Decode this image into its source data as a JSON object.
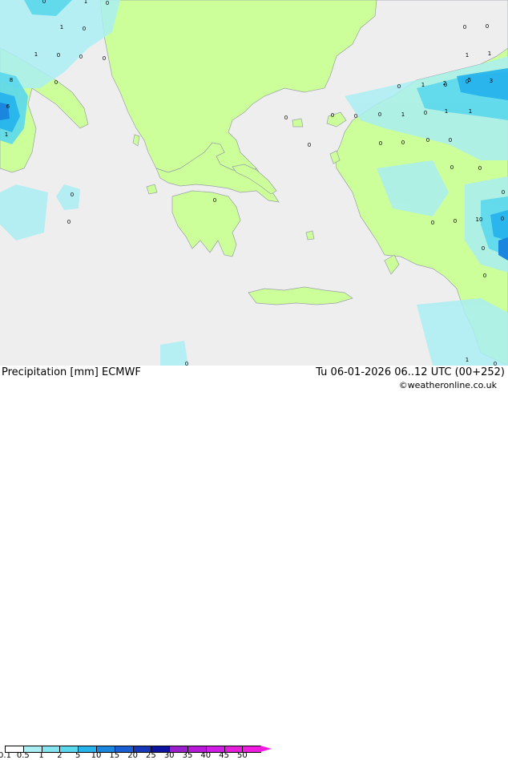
{
  "header": {
    "title": "Precipitation [mm] ECMWF",
    "run_info": "Tu 06-01-2026 06..12 UTC (00+252)",
    "credit": "©weatheronline.co.uk"
  },
  "colors": {
    "sea": "#eeeeee",
    "land": "#ccff99",
    "coast": "#9aa0a6",
    "rain_light": "#aaeef3",
    "rain_mid": "#5bd8ec",
    "rain_heavy": "#27b4ec",
    "rain_core": "#1a86de"
  },
  "legend": {
    "labels": [
      "0.1",
      "0.5",
      "1",
      "2",
      "5",
      "10",
      "15",
      "20",
      "25",
      "30",
      "35",
      "40",
      "45",
      "50"
    ],
    "colors": [
      "#ffffff",
      "#aaeef3",
      "#86e3f0",
      "#5bd8ec",
      "#27b4ec",
      "#1a86de",
      "#1a5fd3",
      "#1638b8",
      "#0c13a0",
      "#9a1fcd",
      "#b91ad9",
      "#d01ee6",
      "#e51ed9",
      "#f21ce0"
    ]
  },
  "values": [
    {
      "t": "1"
    },
    {
      "t": "0"
    },
    {
      "t": "0"
    },
    {
      "t": "1"
    },
    {
      "t": "0"
    },
    {
      "t": "1"
    },
    {
      "t": "0"
    },
    {
      "t": "0"
    },
    {
      "t": "0"
    },
    {
      "t": "8"
    },
    {
      "t": "6"
    },
    {
      "t": "1"
    },
    {
      "t": "0"
    },
    {
      "t": "0"
    },
    {
      "t": "0"
    },
    {
      "t": "0"
    },
    {
      "t": "0"
    },
    {
      "t": "0"
    },
    {
      "t": "0"
    },
    {
      "t": "0"
    },
    {
      "t": "0"
    },
    {
      "t": "0"
    },
    {
      "t": "0"
    },
    {
      "t": "0"
    },
    {
      "t": "0"
    },
    {
      "t": "0"
    },
    {
      "t": "0"
    },
    {
      "t": "0"
    },
    {
      "t": "1"
    },
    {
      "t": "0"
    },
    {
      "t": "0"
    },
    {
      "t": "1"
    },
    {
      "t": "1"
    },
    {
      "t": "2"
    },
    {
      "t": "5"
    },
    {
      "t": "3"
    },
    {
      "t": "0"
    },
    {
      "t": "0"
    },
    {
      "t": "0"
    },
    {
      "t": "0"
    },
    {
      "t": "0"
    },
    {
      "t": "0"
    },
    {
      "t": "0"
    },
    {
      "t": "0"
    },
    {
      "t": "1"
    },
    {
      "t": "10"
    },
    {
      "t": "1"
    },
    {
      "t": "1"
    },
    {
      "t": "0"
    },
    {
      "t": "1"
    },
    {
      "t": "0"
    },
    {
      "t": "0"
    }
  ]
}
